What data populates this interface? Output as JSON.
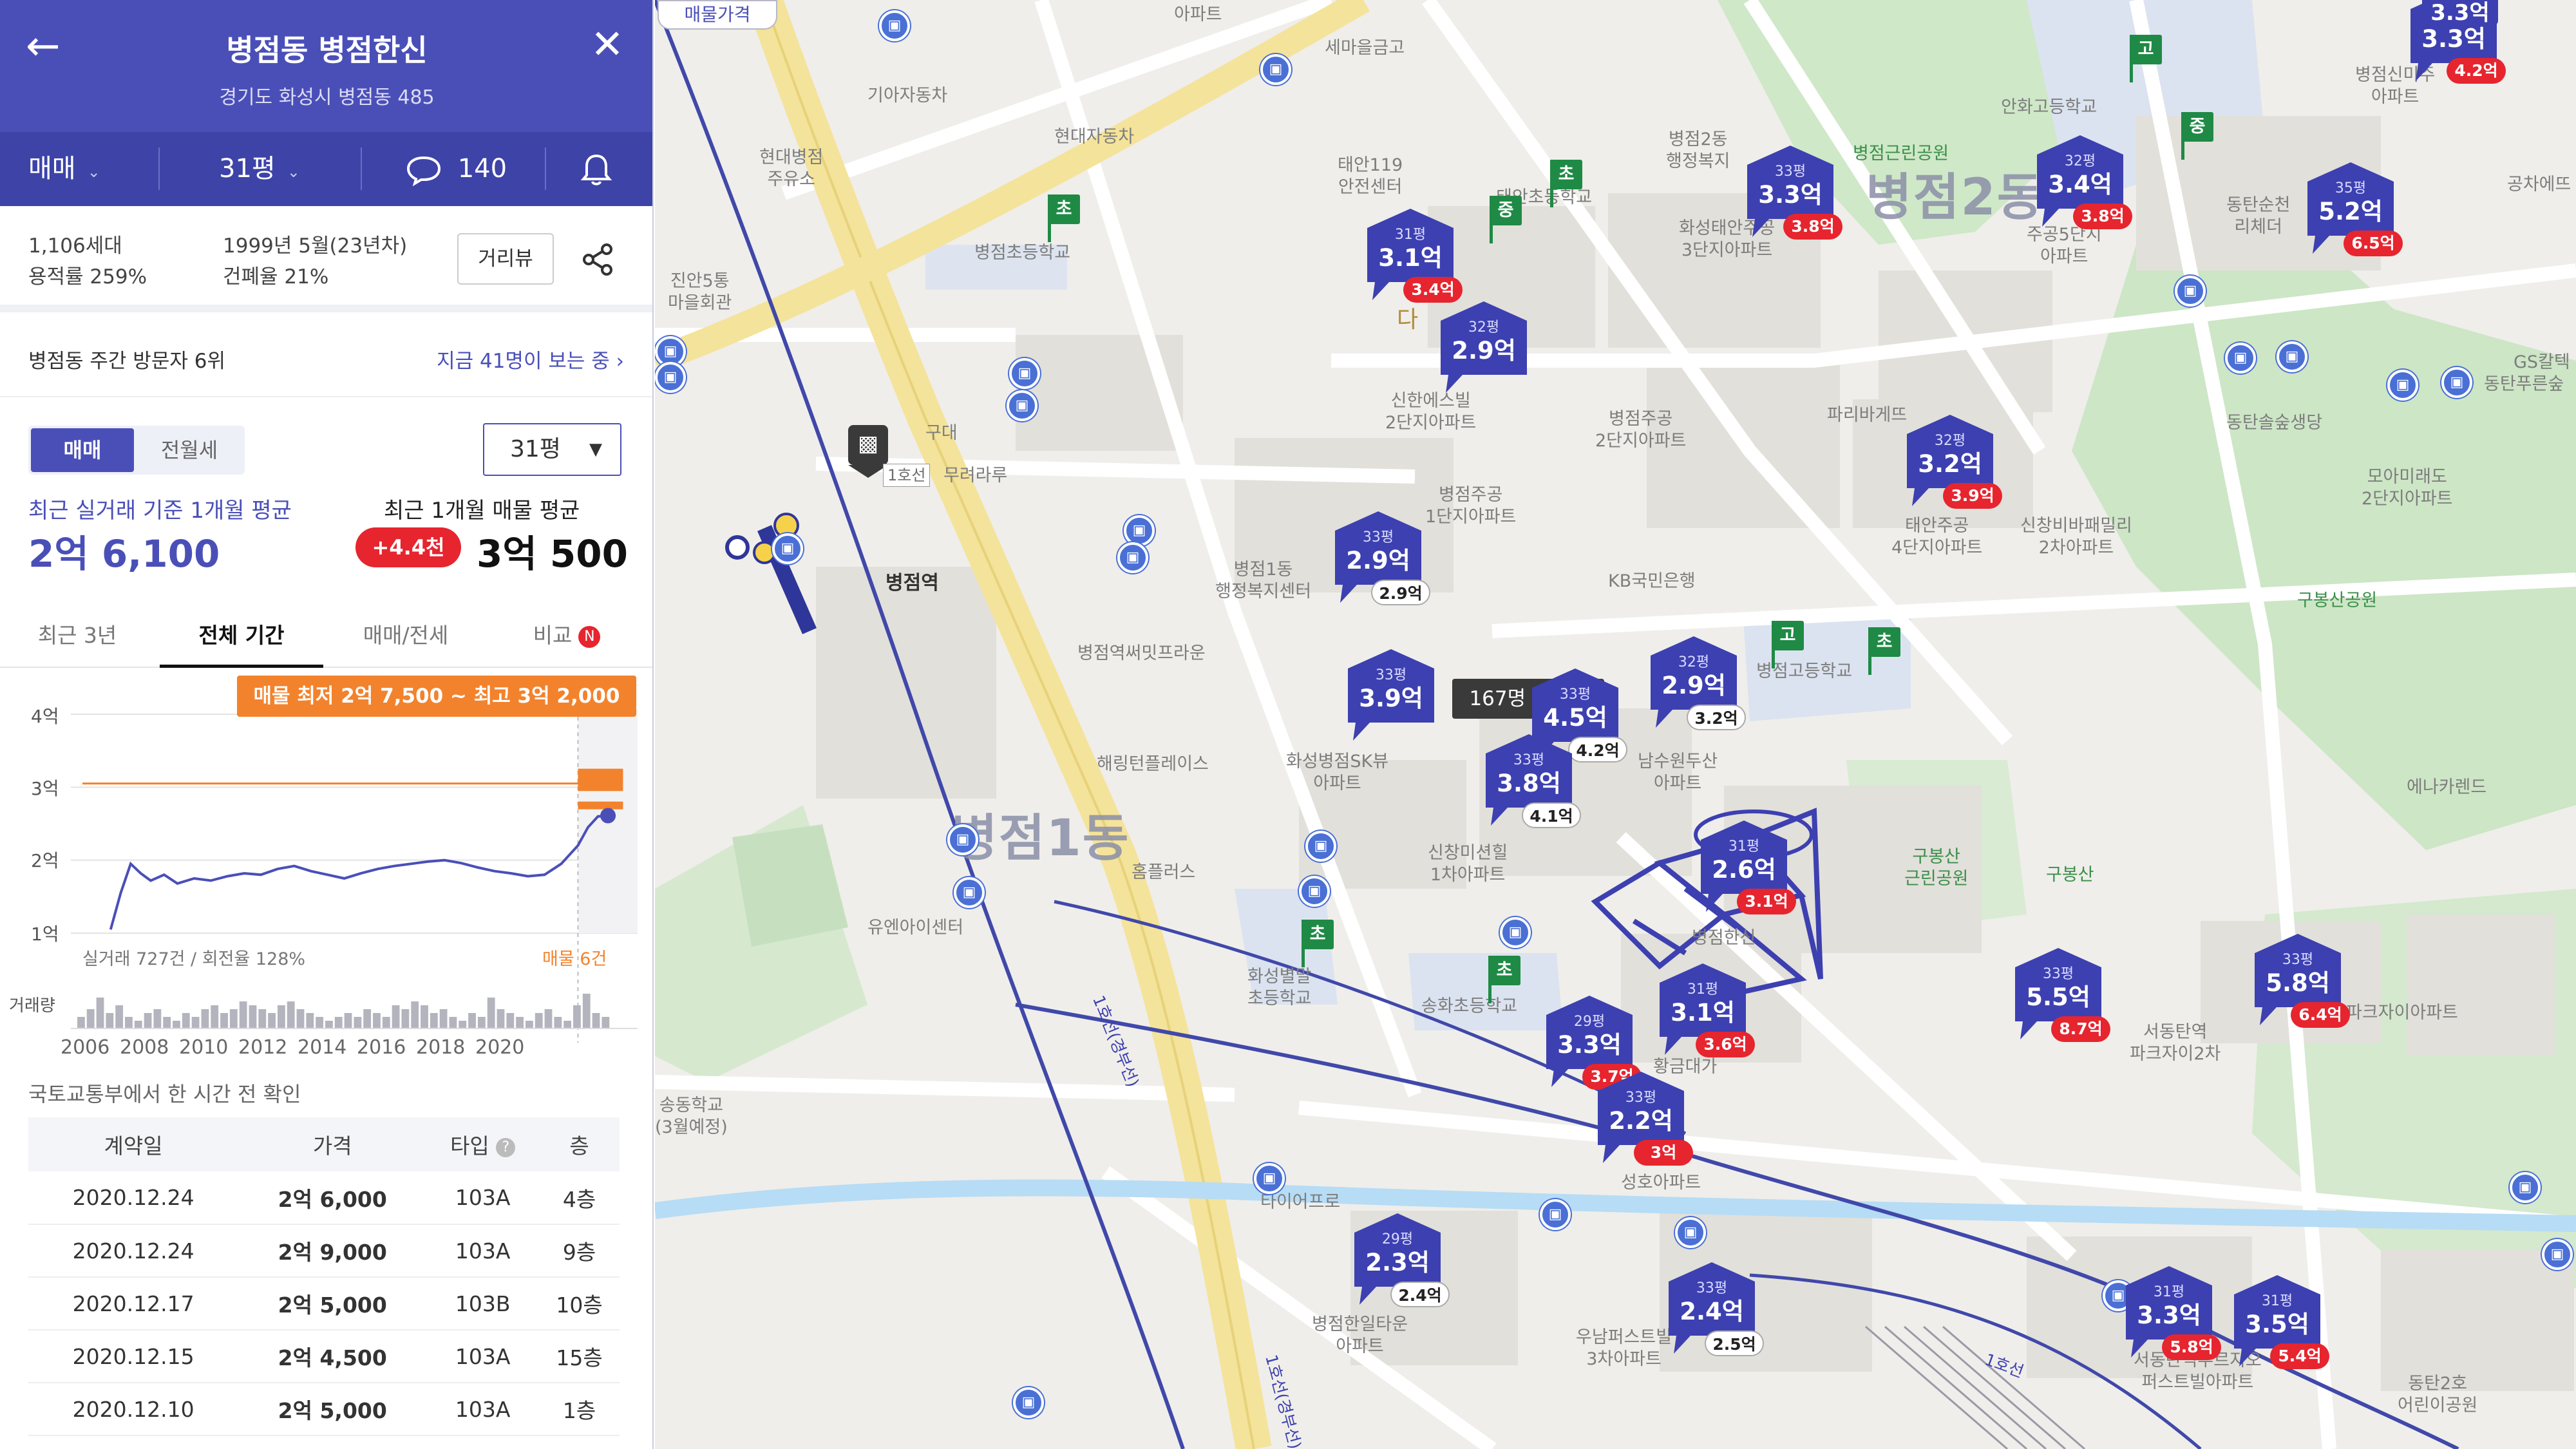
{
  "header": {
    "title": "병점동 병점한신",
    "address": "경기도 화성시 병점동 485"
  },
  "toolbar": {
    "trade_type": "매매",
    "pyeong": "31평",
    "comment_count": "140"
  },
  "info": {
    "households": "1,106세대",
    "floor_area_ratio": "용적률 259%",
    "built": "1999년 5월(23년차)",
    "coverage_ratio": "건폐율 21%",
    "street_view_button": "거리뷰"
  },
  "visitor": {
    "rank_text": "병점동 주간 방문자 6위",
    "live_text": "지금 41명이 보는 중 ›"
  },
  "price": {
    "seg_active": "매매",
    "seg_inactive": "전월세",
    "pyeong_select": "31평",
    "real_label": "최근 실거래 기준 1개월 평균",
    "listing_label": "최근 1개월 매물 평균",
    "real_value": "2억 6,100",
    "change_badge": "+4.4천",
    "listing_value": "3억 500"
  },
  "period_tabs": {
    "t1": "최근 3년",
    "t2": "전체 기간",
    "t3": "매매/전세",
    "t4": "비교",
    "t4_badge": "N"
  },
  "chart_data": {
    "type": "line",
    "listing_range_tag": "매물 최저 2억 7,500 ~ 최고 3억 2,000",
    "y_ticks": [
      "4억",
      "3억",
      "2억",
      "1억"
    ],
    "ylim": [
      1,
      4
    ],
    "x_ticks": [
      "2006",
      "2008",
      "2010",
      "2012",
      "2014",
      "2016",
      "2018",
      "2020"
    ],
    "real_trades_note": "실거래 727건 / 회전율 128%",
    "listing_count_note": "매물 6건",
    "volume_label": "거래량",
    "series": [
      {
        "name": "실거래",
        "x": [
          2006.0,
          2006.3,
          2006.6,
          2006.9,
          2007.2,
          2007.6,
          2008.0,
          2008.5,
          2009.0,
          2009.5,
          2010.0,
          2010.5,
          2011.0,
          2011.5,
          2012.0,
          2012.5,
          2013.0,
          2013.5,
          2014.0,
          2014.5,
          2015.0,
          2015.5,
          2016.0,
          2016.5,
          2017.0,
          2017.5,
          2018.0,
          2018.5,
          2019.0,
          2019.5,
          2020.0,
          2020.3,
          2020.6,
          2020.9
        ],
        "values": [
          1.05,
          1.55,
          1.95,
          1.82,
          1.72,
          1.8,
          1.68,
          1.75,
          1.72,
          1.78,
          1.82,
          1.8,
          1.88,
          1.92,
          1.85,
          1.8,
          1.75,
          1.82,
          1.88,
          1.92,
          1.95,
          1.98,
          2.0,
          1.96,
          1.9,
          1.85,
          1.82,
          1.78,
          1.8,
          1.95,
          2.2,
          2.45,
          2.6,
          2.61
        ]
      }
    ],
    "listing_avg": 3.05,
    "listing_min": 2.75,
    "listing_max": 3.2,
    "volume": [
      3,
      5,
      8,
      4,
      6,
      3,
      2,
      4,
      5,
      3,
      2,
      4,
      3,
      5,
      6,
      4,
      5,
      7,
      6,
      5,
      4,
      6,
      7,
      5,
      4,
      3,
      2,
      3,
      4,
      3,
      5,
      4,
      3,
      6,
      5,
      7,
      6,
      4,
      5,
      3,
      2,
      4,
      3,
      8,
      5,
      4,
      3,
      2,
      4,
      5,
      3,
      2,
      6,
      9,
      4,
      3
    ]
  },
  "deals": {
    "source_note": "국토교통부에서 한 시간 전 확인",
    "headers": [
      "계약일",
      "가격",
      "타입",
      "층"
    ],
    "rows": [
      [
        "2020.12.24",
        "2억 6,000",
        "103A",
        "4층"
      ],
      [
        "2020.12.24",
        "2억 9,000",
        "103A",
        "9층"
      ],
      [
        "2020.12.17",
        "2억 5,000",
        "103B",
        "10층"
      ],
      [
        "2020.12.15",
        "2억 4,500",
        "103A",
        "15층"
      ],
      [
        "2020.12.10",
        "2억 5,000",
        "103A",
        "1층"
      ]
    ]
  },
  "map": {
    "price_tag": "매물가격",
    "viewers": "167명 보는중",
    "district1": "병점1동",
    "district2": "병점2동",
    "station_name": "병점역",
    "station_exit": "1호선",
    "pins": [
      {
        "py": "31평",
        "price": "3.1억",
        "sub": "3.4억",
        "red": true
      },
      {
        "py": "32평",
        "price": "2.9억",
        "sub": "",
        "red": false
      },
      {
        "py": "33평",
        "price": "3.3억",
        "sub": "3.8억",
        "red": true
      },
      {
        "py": "32평",
        "price": "3.4억",
        "sub": "3.8억",
        "red": true
      },
      {
        "py": "35평",
        "price": "5.2억",
        "sub": "6.5억",
        "red": true
      },
      {
        "py": "33평",
        "price": "3.3억",
        "sub": "4.2억",
        "red": true
      },
      {
        "py": "32평",
        "price": "3.2억",
        "sub": "3.9억",
        "red": true
      },
      {
        "py": "33평",
        "price": "2.9억",
        "sub": "2.9억",
        "red": false
      },
      {
        "py": "33평",
        "price": "4.5억",
        "sub": "4.2억",
        "red": false
      },
      {
        "py": "33평",
        "price": "3.9억",
        "sub": "",
        "red": false
      },
      {
        "py": "32평",
        "price": "2.9억",
        "sub": "3.2억",
        "red": false
      },
      {
        "py": "33평",
        "price": "3.8억",
        "sub": "4.1억",
        "red": false
      },
      {
        "py": "31평",
        "price": "2.6억",
        "sub": "3.1억",
        "red": true
      },
      {
        "py": "31평",
        "price": "3.1억",
        "sub": "3.6억",
        "red": true
      },
      {
        "py": "29평",
        "price": "3.3억",
        "sub": "3.7억",
        "red": true
      },
      {
        "py": "33평",
        "price": "2.2억",
        "sub": "3억",
        "red": true
      },
      {
        "py": "33평",
        "price": "5.5억",
        "sub": "8.7억",
        "red": true
      },
      {
        "py": "33평",
        "price": "5.8억",
        "sub": "6.4억",
        "red": true
      },
      {
        "py": "29평",
        "price": "2.3억",
        "sub": "2.4억",
        "red": false
      },
      {
        "py": "33평",
        "price": "2.4억",
        "sub": "2.5억",
        "red": false
      },
      {
        "py": "31평",
        "price": "3.3억",
        "sub": "5.8억",
        "red": true
      },
      {
        "py": "31평",
        "price": "3.5억",
        "sub": "5.4억",
        "red": true
      }
    ],
    "labels": {
      "l1": "기아자동차",
      "l2": "현대자동차",
      "l3": "현대병점\n주유소",
      "l4": "태안119\n안전센터",
      "l5": "세마을금고",
      "l6": "병점초등학교",
      "l7": "진안5통\n마을회관",
      "l8": "병점2동\n행정복지",
      "l9": "화성태안주공\n3단지아파트",
      "l10": "병점근린공원",
      "l11": "안화고등학교",
      "l12": "병점신미주\n아파트",
      "l13": "신한에스빌\n2단지아파트",
      "l14": "병점주공\n2단지아파트",
      "l15": "파리바게뜨",
      "l16": "동탄순천\n리체더",
      "l17": "주공5단지\n아파트",
      "l18": "병점1동\n행정복지센터",
      "l19": "병점주공\n1단지아파트",
      "l20": "KB국민은행",
      "l21": "태안주공\n4단지아파트",
      "l22": "신창비바패밀리\n2차아파트",
      "l23": "동탄솔숲생당",
      "l24": "모아미래도\n2단지아파트",
      "l25": "구봉산공원",
      "l26": "병점역써밋프라운",
      "l27": "해링턴플레이스",
      "l28": "화성병점SK뷰\n아파트",
      "l29": "남수원두산\n아파트",
      "l30": "신창미션힐\n1차아파트",
      "l31": "유엔아이센터",
      "l32": "홈플러스",
      "l33": "구봉산\n근린공원",
      "l34": "구봉산",
      "l35": "에나카렌드",
      "l36": "화성별말\n초등학교",
      "l37": "송화초등학교",
      "l38": "병점한신",
      "l39": "서동탄역\n파크자이2차",
      "l40": "파크자이아파트",
      "l41": "황금대가",
      "l42": "성호아파트",
      "l43": "타이어프로",
      "l44": "병점한일타운\n아파트",
      "l45": "우남퍼스트빌\n3차아파트",
      "l46": "서동탄역푸르지오\n퍼스트빌아파트",
      "l47": "동탄2호\n어린이공원",
      "l48": "동탄푸른숲",
      "l49": "무려라루",
      "l50": "공차에뜨",
      "l51": "GS칼텍",
      "l52": "병점고등학교",
      "l53": "태안초등학교",
      "l54": "송동학교\n(3월예정)",
      "l55": "구대",
      "l56": "아파트",
      "l57": "다",
      "l58": "1호선(경부선)",
      "l59": "1호선(경부선)",
      "l60": "1호선",
      "l61": "3.3억"
    }
  },
  "colors": {
    "brand": "#4a4fb8",
    "pin": "#3d40b0",
    "red": "#e6252f",
    "orange": "#f3822c",
    "school": "#1f8a45"
  },
  "icons": {
    "back": "arrow-left-icon",
    "close": "close-icon",
    "comment": "chat-bubble-icon",
    "bell": "bell-icon",
    "share": "share-icon"
  }
}
